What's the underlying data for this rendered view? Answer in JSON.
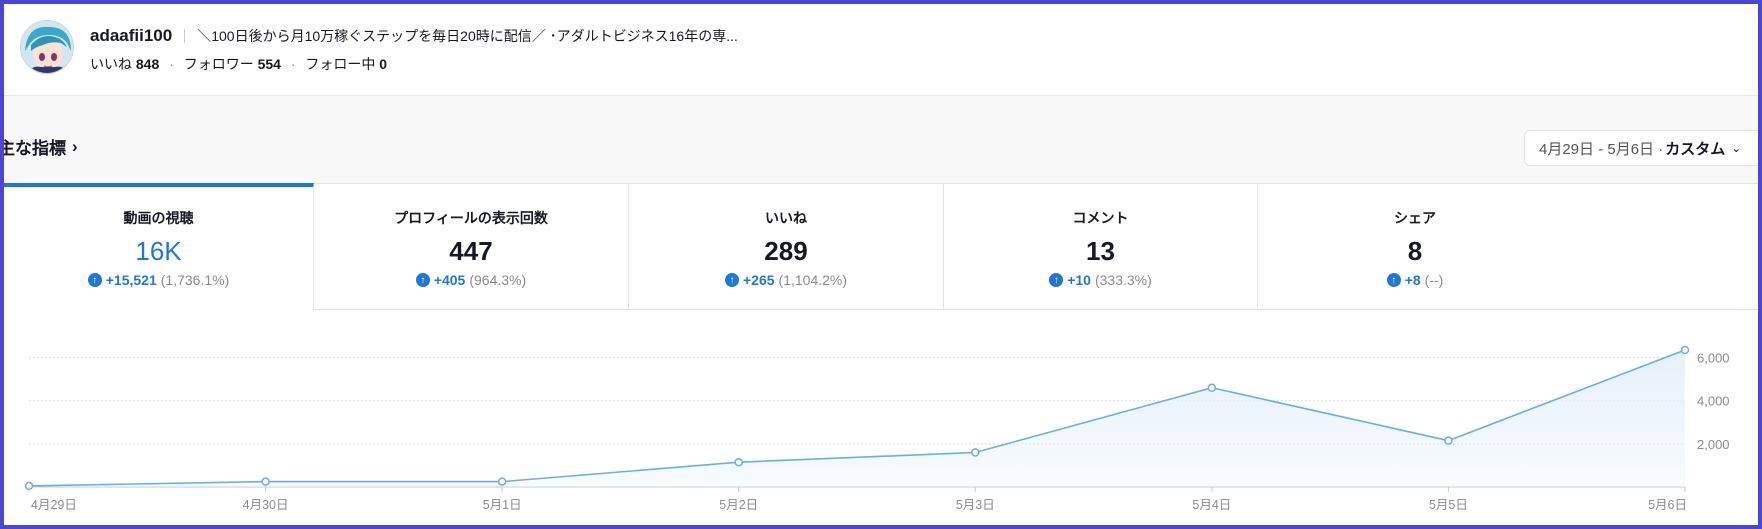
{
  "header": {
    "username": "adaafii100",
    "bio": "＼100日後から月10万稼ぐステップを毎日20時に配信／ ･アダルトビジネス16年の専...",
    "likes_label": "いいね",
    "likes_value": "848",
    "followers_label": "フォロワー",
    "followers_value": "554",
    "following_label": "フォロー中",
    "following_value": "0"
  },
  "section": {
    "title": "主な指標",
    "chevron": "›"
  },
  "date_picker": {
    "range": "4月29日 - 5月6日 ·",
    "mode": "カスタム",
    "caret": "⌄"
  },
  "cards": [
    {
      "label": "動画の視聴",
      "value": "16K",
      "plus": "+15,521",
      "pct": "(1,736.1%)"
    },
    {
      "label": "プロフィールの表示回数",
      "value": "447",
      "plus": "+405",
      "pct": "(964.3%)"
    },
    {
      "label": "いいね",
      "value": "289",
      "plus": "+265",
      "pct": "(1,104.2%)"
    },
    {
      "label": "コメント",
      "value": "13",
      "plus": "+10",
      "pct": "(333.3%)"
    },
    {
      "label": "シェア",
      "value": "8",
      "plus": "+8",
      "pct": "(--)"
    }
  ],
  "colors": {
    "accent": "#1f77d8",
    "line": "#6aaee8",
    "area": "#e6f1fb",
    "frame": "#4a46d6"
  },
  "chart_data": {
    "type": "area",
    "x": [
      "4月29日",
      "4月30日",
      "5月1日",
      "5月2日",
      "5月3日",
      "5月4日",
      "5月5日",
      "5月6日"
    ],
    "values": [
      50,
      250,
      250,
      1150,
      1600,
      4600,
      2150,
      6350
    ],
    "yticks": [
      "2,000",
      "4,000",
      "6,000"
    ],
    "ytick_values": [
      2000,
      4000,
      6000
    ],
    "ylim": [
      0,
      6350
    ],
    "grid": true,
    "y_axis_position": "right"
  }
}
